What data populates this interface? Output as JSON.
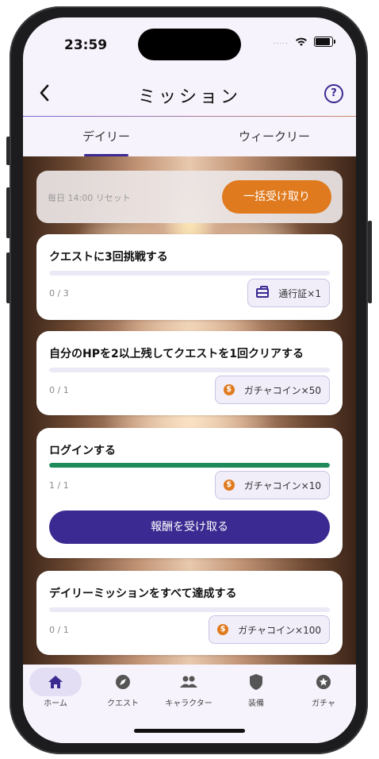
{
  "status_bar": {
    "time": "23:59",
    "signal_dots": "....."
  },
  "header": {
    "back": "<",
    "title": "ミッション",
    "help": "?"
  },
  "tabs": {
    "daily": "デイリー",
    "weekly": "ウィークリー"
  },
  "reset": {
    "text": "毎日 14:00 リセット",
    "claim_all": "一括受け取り"
  },
  "missions": [
    {
      "title": "クエストに3回挑戦する",
      "progress_text": "0 / 3",
      "progress": 0,
      "reward_icon": "ticket-icon",
      "reward": "通行証×1"
    },
    {
      "title": "自分のHPを2以上残してクエストを1回クリアする",
      "progress_text": "0 / 1",
      "progress": 0,
      "reward_icon": "coin-icon",
      "reward": "ガチャコイン×50"
    },
    {
      "title": "ログインする",
      "progress_text": "1 / 1",
      "progress": 1,
      "reward_icon": "coin-icon",
      "reward": "ガチャコイン×10",
      "claim_label": "報酬を受け取る"
    },
    {
      "title": "デイリーミッションをすべて達成する",
      "progress_text": "0 / 1",
      "progress": 0,
      "reward_icon": "coin-icon",
      "reward": "ガチャコイン×100"
    }
  ],
  "nav": [
    {
      "label": "ホーム",
      "icon": "home-icon",
      "active": true
    },
    {
      "label": "クエスト",
      "icon": "compass-icon"
    },
    {
      "label": "キャラクター",
      "icon": "people-icon"
    },
    {
      "label": "装備",
      "icon": "shield-icon"
    },
    {
      "label": "ガチャ",
      "icon": "star-badge-icon"
    }
  ],
  "colors": {
    "accent": "#3a2a91",
    "orange": "#e07a1e",
    "progress_green": "#1e8a5a"
  }
}
